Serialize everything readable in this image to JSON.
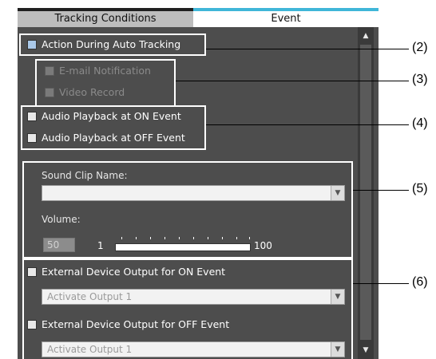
{
  "tabs": {
    "left": "Tracking Conditions",
    "right": "Event"
  },
  "section2": {
    "action_label": "Action During Auto Tracking"
  },
  "section3": {
    "email_label": "E-mail Notification",
    "video_label": "Video Record"
  },
  "section4": {
    "on_label": "Audio Playback at ON Event",
    "off_label": "Audio Playback at OFF Event"
  },
  "section5": {
    "sound_clip_label": "Sound Clip Name:",
    "sound_clip_value": "",
    "volume_label": "Volume:",
    "volume_value": "50",
    "slider_min": "1",
    "slider_max": "100"
  },
  "section6": {
    "on_label": "External Device Output for ON Event",
    "on_select": "Activate Output 1",
    "off_label": "External Device Output for OFF Event",
    "off_select": "Activate Output 1"
  },
  "callouts": {
    "c2": "(2)",
    "c3": "(3)",
    "c4": "(4)",
    "c5": "(5)",
    "c6": "(6)"
  },
  "icons": {
    "dropdown": "chevron-down-icon",
    "scroll_up": "arrow-up-icon",
    "scroll_down": "arrow-down-icon"
  }
}
